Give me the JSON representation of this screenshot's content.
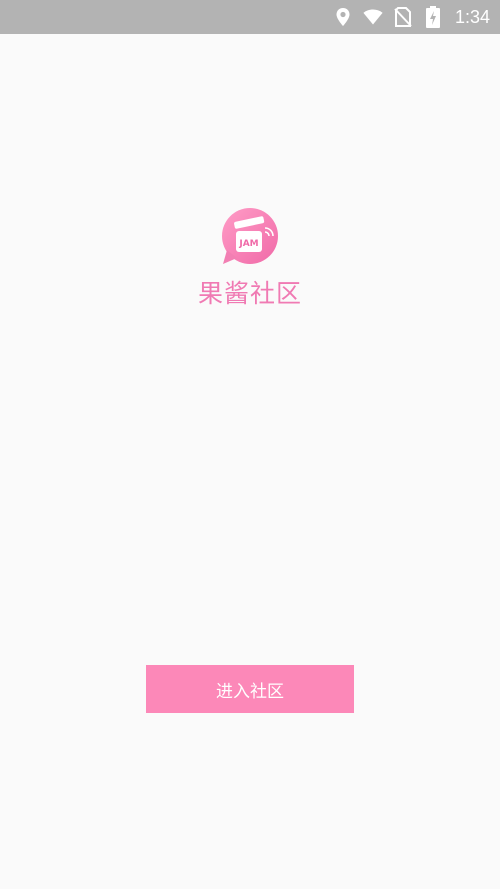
{
  "status_bar": {
    "time": "1:34",
    "icons": [
      "location-icon",
      "wifi-icon",
      "no-sim-icon",
      "battery-charging-icon"
    ]
  },
  "app": {
    "logo_text": "JAM",
    "title": "果酱社区"
  },
  "actions": {
    "enter_label": "进入社区"
  },
  "colors": {
    "status_bar_bg": "#b3b3b3",
    "background": "#fafafa",
    "brand_pink": "#f07ab3",
    "button_pink": "#fc88b8"
  }
}
